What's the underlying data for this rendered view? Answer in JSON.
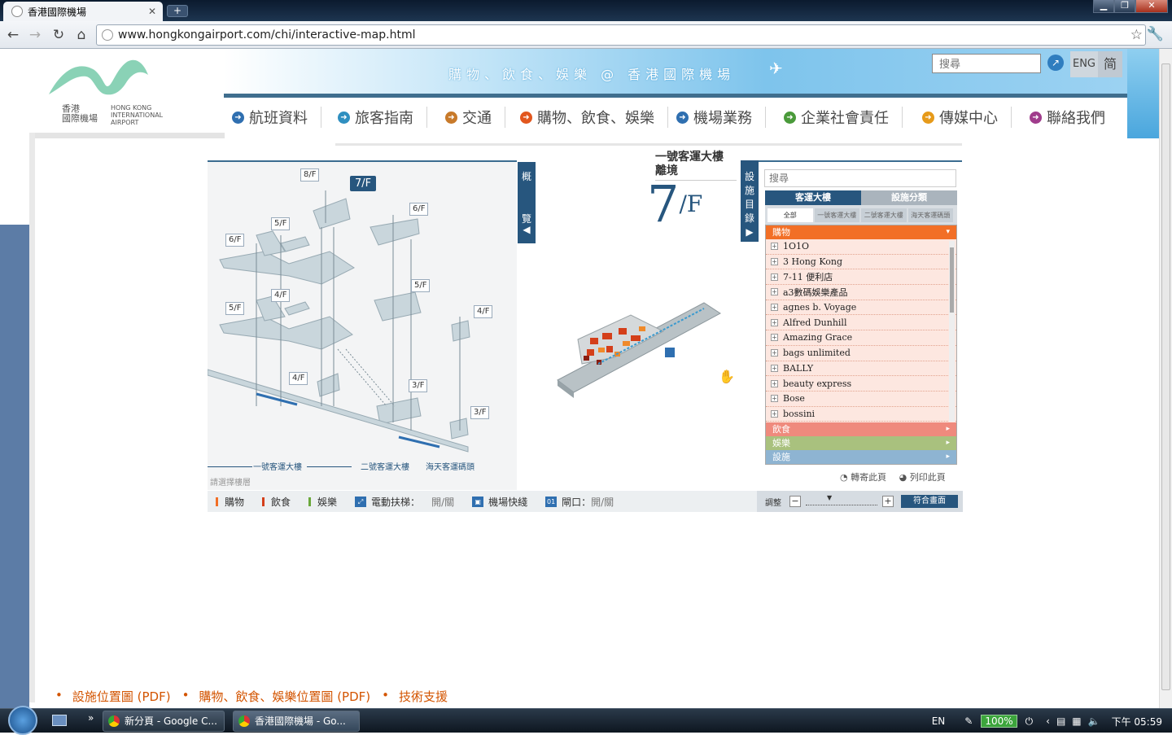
{
  "browser": {
    "tab_title": "香港國際機場",
    "url": "www.hongkongairport.com/chi/interactive-map.html"
  },
  "site": {
    "logo_zh": "香港\n國際機場",
    "logo_en": "HONG KONG\nINTERNATIONAL\nAIRPORT",
    "slogan": "購物、飲食、娛樂 @ 香港國際機場",
    "search_placeholder": "搜尋",
    "lang_eng": "ENG",
    "lang_sc": "简",
    "nav": [
      {
        "label": "航班資料",
        "color": "#2f6fb0"
      },
      {
        "label": "旅客指南",
        "color": "#2f8fc0"
      },
      {
        "label": "交通",
        "color": "#c87a2a"
      },
      {
        "label": "購物、飲食、娛樂",
        "color": "#e2571e"
      },
      {
        "label": "機場業務",
        "color": "#2f6fb0"
      },
      {
        "label": "企業社會責任",
        "color": "#4a9a3a"
      },
      {
        "label": "傳媒中心",
        "color": "#e69a1a"
      },
      {
        "label": "聯絡我們",
        "color": "#a03c8c"
      }
    ]
  },
  "map": {
    "overview_toggle": "概\n\n\n\n覽",
    "selected_floor": "7/F",
    "floor_labels": [
      "8/F",
      "6/F",
      "5/F",
      "6/F",
      "5/F",
      "4/F",
      "5/F",
      "4/F",
      "4/F",
      "3/F",
      "3/F"
    ],
    "terminal_legend": [
      "一號客運大樓",
      "二號客運大樓",
      "海天客運碼頭"
    ],
    "hint": "請選擇樓層",
    "terminal_name": "一號客運大樓\n離境",
    "big_floor": "7",
    "big_floor_suffix": "/F",
    "legend": {
      "shopping": "購物",
      "dining": "飲食",
      "entertainment": "娛樂",
      "escalator": "電動扶梯：",
      "escalator_toggle": "開/關",
      "express": "機場快綫",
      "gate": "閘口：",
      "gate_toggle": "開/關"
    },
    "zoom_label": "調整",
    "fit_button": "符合畫面"
  },
  "directory": {
    "toggle": "設\n施\n目\n錄",
    "search_placeholder": "搜尋",
    "tabs": [
      "客運大樓",
      "設施分類"
    ],
    "subtabs": [
      "全部",
      "一號客運大樓",
      "二號客運大樓",
      "海天客運碼頭"
    ],
    "categories": {
      "shopping": {
        "label": "購物",
        "color": "#f26f26"
      },
      "dining": {
        "label": "飲食",
        "color": "#ef8a7d"
      },
      "entertainment": {
        "label": "娛樂",
        "color": "#a9c17e"
      },
      "facilities": {
        "label": "設施",
        "color": "#8eb4d2"
      }
    },
    "shops": [
      "1O1O",
      "3 Hong Kong",
      "7-11 便利店",
      "a3數碼娛樂產品",
      "agnes b. Voyage",
      "Alfred Dunhill",
      "Amazing Grace",
      "bags unlimited",
      "BALLY",
      "beauty express",
      "Bose",
      "bossini"
    ],
    "email_page": "轉寄此頁",
    "print_page": "列印此頁"
  },
  "footer_links": [
    "設施位置圖 (PDF)",
    "購物、飲食、娛樂位置圖 (PDF)",
    "技術支援"
  ],
  "taskbar": {
    "task1": "新分頁 - Google C...",
    "task2": "香港國際機場 - Go...",
    "lang": "EN",
    "battery": "100%",
    "clock": "下午 05:59"
  }
}
